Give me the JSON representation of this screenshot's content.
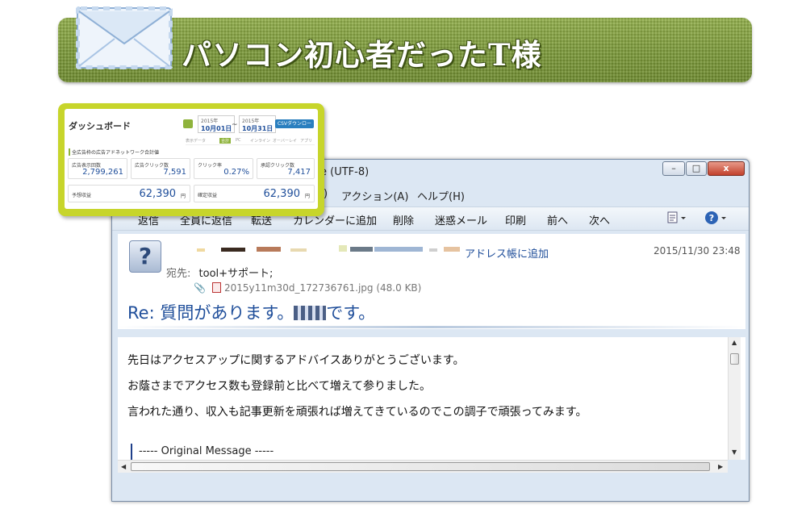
{
  "banner": {
    "title": "パソコン初心者だったT様"
  },
  "window": {
    "title": "e (UTF-8)",
    "controls": {
      "minimize": "–",
      "maximize": "□",
      "close": "x"
    },
    "menu": [
      ")",
      "アクション(A)",
      "ヘルプ(H)"
    ],
    "toolbar": [
      "返信",
      "全員に返信",
      "転送",
      "カレンダーに追加",
      "削除",
      "迷惑メール",
      "印刷",
      "前へ",
      "次へ"
    ]
  },
  "email": {
    "add_to_address_book": "アドレス帳に追加",
    "date": "2015/11/30 23:48",
    "to_label": "宛先:",
    "to_value": "tool+サポート;",
    "attachment": "2015y11m30d_172736761.jpg (48.0 KB)",
    "subject_prefix": "Re: 質問があります。",
    "subject_suffix": "です。",
    "body": [
      "先日はアクセスアップに関するアドバイスありがとうございます。",
      "お蔭さまでアクセス数も登録前と比べて増えて参りました。",
      "言われた通り、収入も記事更新を頑張れば増えてきているのでこの調子で頑張ってみます。"
    ],
    "original_message": "----- Original Message -----"
  },
  "dashboard": {
    "title": "ダッシュボード",
    "date_from_year": "2015年",
    "date_from": "10月01日",
    "date_to_year": "2015年",
    "date_to": "10月31日",
    "tilde": "~",
    "csv_button": "CSVダウンロード",
    "filters": [
      "表示データ",
      "合計",
      "PC",
      "インライン",
      "オーバーレイ",
      "アプリ"
    ],
    "section_title": "全広告枠の広告アドネットワーク合計値",
    "cards": [
      {
        "label": "広告表示回数",
        "value": "2,799,261"
      },
      {
        "label": "広告クリック数",
        "value": "7,591"
      },
      {
        "label": "クリック率",
        "value": "0.27%"
      },
      {
        "label": "承認クリック数",
        "value": "7,417"
      }
    ],
    "revenue": [
      {
        "label": "予想収益",
        "value": "62,390",
        "unit": "円"
      },
      {
        "label": "確定収益",
        "value": "62,390",
        "unit": "円"
      }
    ]
  },
  "colors": {
    "banner_green": "#7c9a3a",
    "dash_frame": "#c7d52b",
    "link_blue": "#1f4e9a"
  }
}
